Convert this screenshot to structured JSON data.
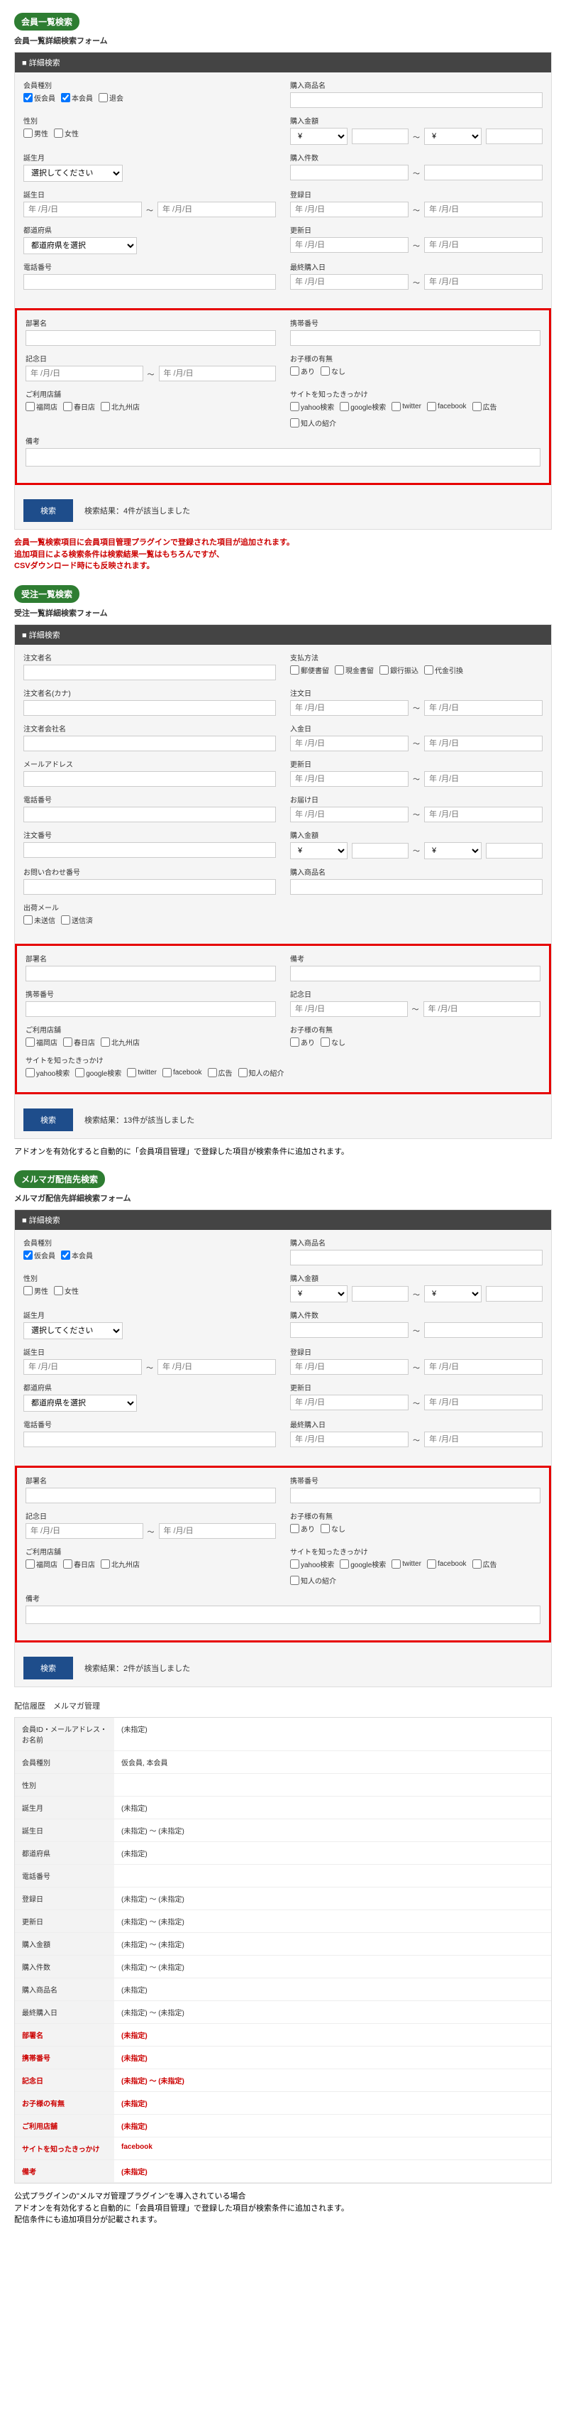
{
  "section1": {
    "title": "会員一覧検索",
    "form_title": "会員一覧詳細検索フォーム",
    "panel_header": "■ 詳細検索",
    "labels": {
      "member_type": "会員種別",
      "gender": "性別",
      "birth_month": "誕生月",
      "birthday": "誕生日",
      "prefecture": "都道府県",
      "phone": "電話番号",
      "product_name": "購入商品名",
      "purchase_amount": "購入金額",
      "purchase_count": "購入件数",
      "register_date": "登録日",
      "update_date": "更新日",
      "last_purchase": "最終購入日",
      "department": "部署名",
      "mobile": "携帯番号",
      "anniversary": "記念日",
      "children": "お子様の有無",
      "children_yes": "あり",
      "children_no": "なし",
      "store_used": "ご利用店舗",
      "trigger": "サイトを知ったきっかけ",
      "remarks": "備考"
    },
    "member_types": [
      "仮会員",
      "本会員",
      "退会"
    ],
    "genders": [
      "男性",
      "女性"
    ],
    "birth_month_placeholder": "選択してください",
    "date_placeholder": "年 /月/日",
    "pref_placeholder": "都道府県を選択",
    "currency": "¥",
    "stores": [
      "福岡店",
      "春日店",
      "北九州店"
    ],
    "triggers": [
      "yahoo検索",
      "google検索",
      "twitter",
      "facebook",
      "広告",
      "知人の紹介"
    ],
    "search_btn": "検索",
    "result": "検索結果：4件が該当しました",
    "note": "会員一覧検索項目に会員項目管理プラグインで登録された項目が追加されます。\n追加項目による検索条件は検索結果一覧はもちろんですが、\nCSVダウンロード時にも反映されます。"
  },
  "section2": {
    "title": "受注一覧検索",
    "form_title": "受注一覧詳細検索フォーム",
    "panel_header": "■ 詳細検索",
    "labels": {
      "orderer_name": "注文者名",
      "orderer_kana": "注文者名(カナ)",
      "orderer_company": "注文者会社名",
      "email": "メールアドレス",
      "phone": "電話番号",
      "order_no": "注文番号",
      "inquiry_no": "お問い合わせ番号",
      "shipping_mail": "出荷メール",
      "shipping_unsent": "未送信",
      "shipping_sent": "送信済",
      "payment_method": "支払方法",
      "order_date": "注文日",
      "payment_date": "入金日",
      "update_date": "更新日",
      "ship_date": "お届け日",
      "purchase_amount": "購入金額",
      "product_name": "購入商品名",
      "department": "部署名",
      "remarks": "備考",
      "mobile": "携帯番号",
      "anniversary": "記念日",
      "store_used": "ご利用店舗",
      "children": "お子様の有無",
      "trigger": "サイトを知ったきっかけ"
    },
    "payment_methods": [
      "郵便書留",
      "現金書留",
      "銀行振込",
      "代金引換"
    ],
    "search_btn": "検索",
    "result": "検索結果：13件が該当しました",
    "note": "アドオンを有効化すると自動的に「会員項目管理」で登録した項目が検索条件に追加されます。"
  },
  "section3": {
    "title": "メルマガ配信先検索",
    "form_title": "メルマガ配信先詳細検索フォーム",
    "panel_header": "■ 詳細検索",
    "search_btn": "検索",
    "result": "検索結果：2件が該当しました"
  },
  "history": {
    "breadcrumb": "配信履歴　メルマガ管理",
    "rows": [
      {
        "label": "会員ID・メールアドレス・お名前",
        "value": "(未指定)"
      },
      {
        "label": "会員種別",
        "value": "仮会員, 本会員"
      },
      {
        "label": "性別",
        "value": ""
      },
      {
        "label": "誕生月",
        "value": "(未指定)"
      },
      {
        "label": "誕生日",
        "value": "(未指定) ～ (未指定)"
      },
      {
        "label": "都道府県",
        "value": "(未指定)"
      },
      {
        "label": "電話番号",
        "value": ""
      },
      {
        "label": "登録日",
        "value": "(未指定) ～ (未指定)"
      },
      {
        "label": "更新日",
        "value": "(未指定) ～ (未指定)"
      },
      {
        "label": "購入金額",
        "value": "(未指定) ～ (未指定)"
      },
      {
        "label": "購入件数",
        "value": "(未指定) ～ (未指定)"
      },
      {
        "label": "購入商品名",
        "value": "(未指定)"
      },
      {
        "label": "最終購入日",
        "value": "(未指定) ～ (未指定)"
      },
      {
        "label": "部署名",
        "value": "(未指定)",
        "highlight": true
      },
      {
        "label": "携帯番号",
        "value": "(未指定)",
        "highlight": true
      },
      {
        "label": "記念日",
        "value": "(未指定) ～ (未指定)",
        "highlight": true
      },
      {
        "label": "お子様の有無",
        "value": "(未指定)",
        "highlight": true
      },
      {
        "label": "ご利用店舗",
        "value": "(未指定)",
        "highlight": true
      },
      {
        "label": "サイトを知ったきっかけ",
        "value": "facebook",
        "highlight": true
      },
      {
        "label": "備考",
        "value": "(未指定)",
        "highlight": true
      }
    ],
    "note": "公式プラグインの\"メルマガ管理プラグイン\"を導入されている場合\nアドオンを有効化すると自動的に「会員項目管理」で登録した項目が検索条件に追加されます。\n配信条件にも追加項目分が記載されます。"
  },
  "common": {
    "tilde": "～",
    "date_placeholder": "年 /月/日",
    "currency": "¥",
    "children_yes": "あり",
    "children_no": "なし",
    "stores": [
      "福岡店",
      "春日店",
      "北九州店"
    ],
    "triggers": [
      "yahoo検索",
      "google検索",
      "twitter",
      "facebook",
      "広告",
      "知人の紹介"
    ]
  }
}
